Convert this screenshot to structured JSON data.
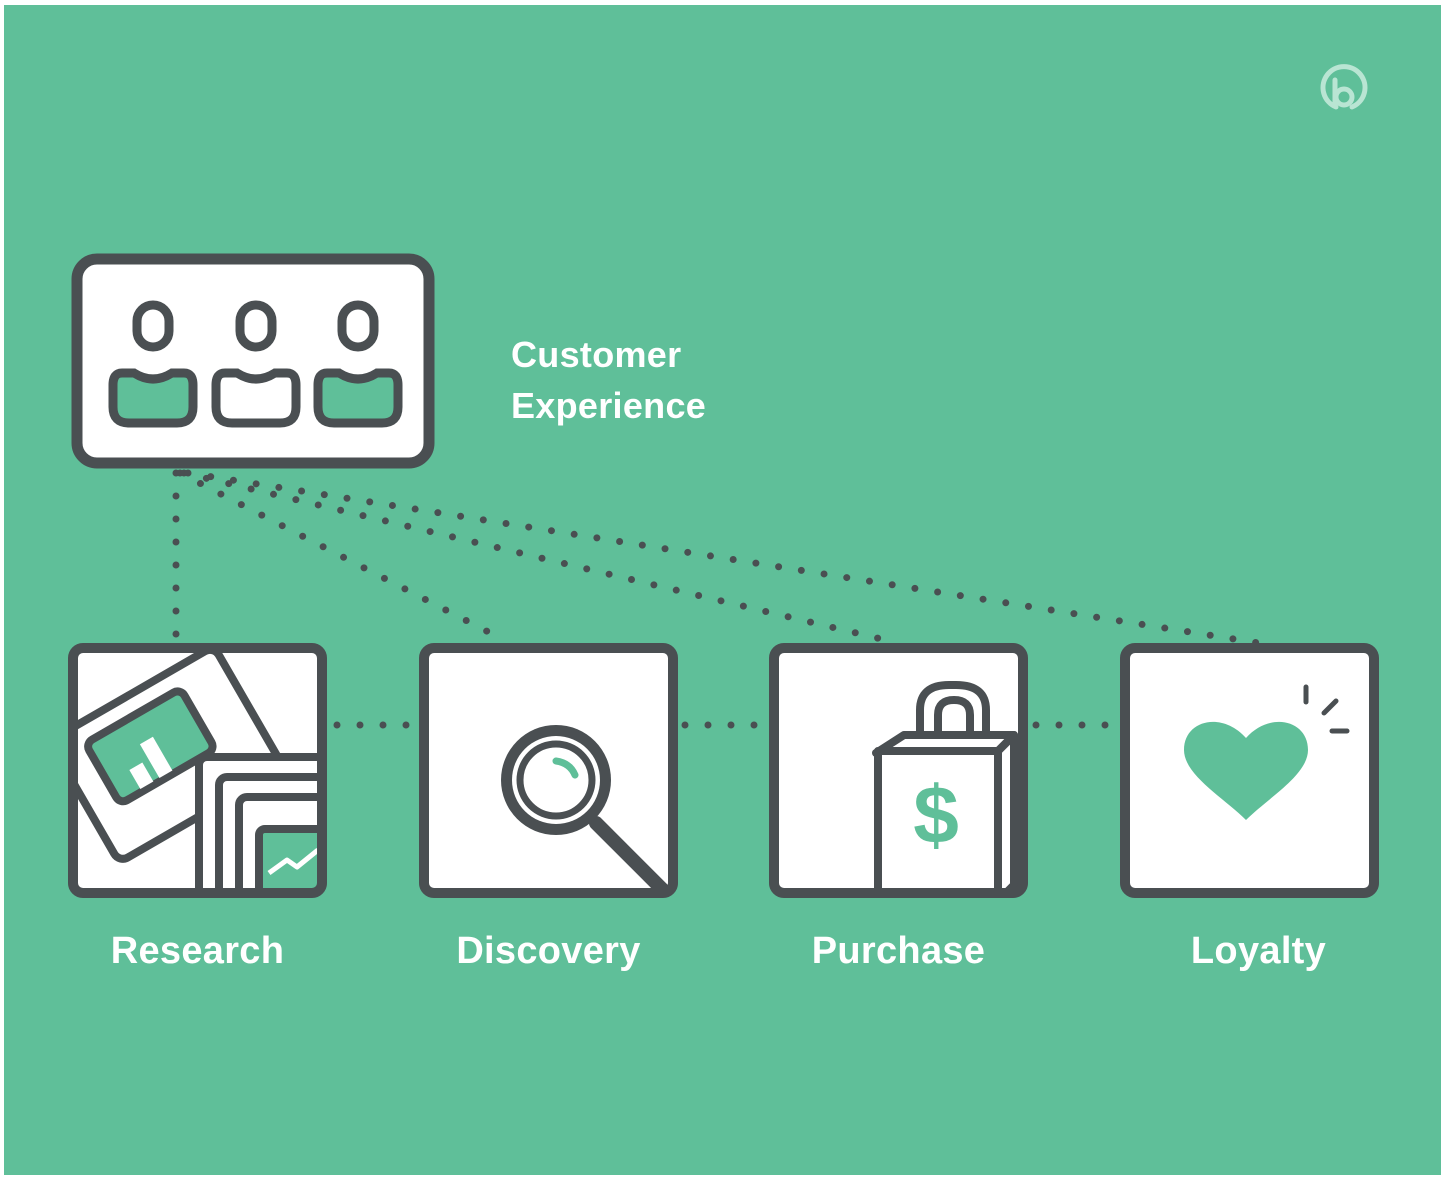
{
  "header": {
    "title_line1": "Customer",
    "title_line2": "Experience"
  },
  "stages": [
    {
      "label": "Research",
      "icon": "research-icon"
    },
    {
      "label": "Discovery",
      "icon": "magnifier-icon"
    },
    {
      "label": "Purchase",
      "icon": "shopping-bag-icon"
    },
    {
      "label": "Loyalty",
      "icon": "heart-icon"
    }
  ],
  "bag_symbol": "$",
  "brand_icon": "bitly-logo-icon",
  "colors": {
    "background": "#5fbf99",
    "stroke": "#4a4f52",
    "accent": "#5fbf99",
    "white": "#ffffff"
  }
}
